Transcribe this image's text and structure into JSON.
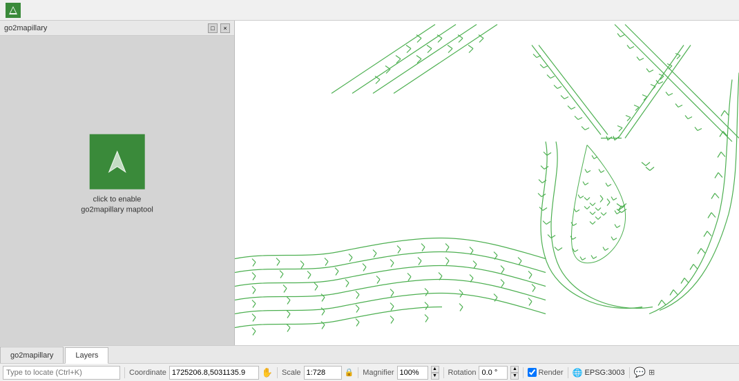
{
  "titlebar": {
    "app_icon_label": "QGIS App Icon"
  },
  "panel": {
    "title": "go2mapillary",
    "restore_btn": "□",
    "close_btn": "×",
    "maptool_text_line1": "click to enable",
    "maptool_text_line2": "go2mapillary maptool"
  },
  "tabs": [
    {
      "id": "go2mapillary",
      "label": "go2mapillary",
      "active": true
    },
    {
      "id": "layers",
      "label": "Layers",
      "active": false
    }
  ],
  "statusbar": {
    "search_placeholder": "Type to locate (Ctrl+K)",
    "coordinate_label": "Coordinate",
    "coordinate_value": "1725206.8,5031135.9",
    "scale_label": "Scale",
    "scale_value": "1:728",
    "magnifier_label": "Magnifier",
    "magnifier_value": "100%",
    "rotation_label": "Rotation",
    "rotation_value": "0.0 °",
    "render_label": "Render",
    "epsg_label": "EPSG:3003"
  },
  "map": {
    "background": "white",
    "arrow_color": "#4caf50"
  }
}
